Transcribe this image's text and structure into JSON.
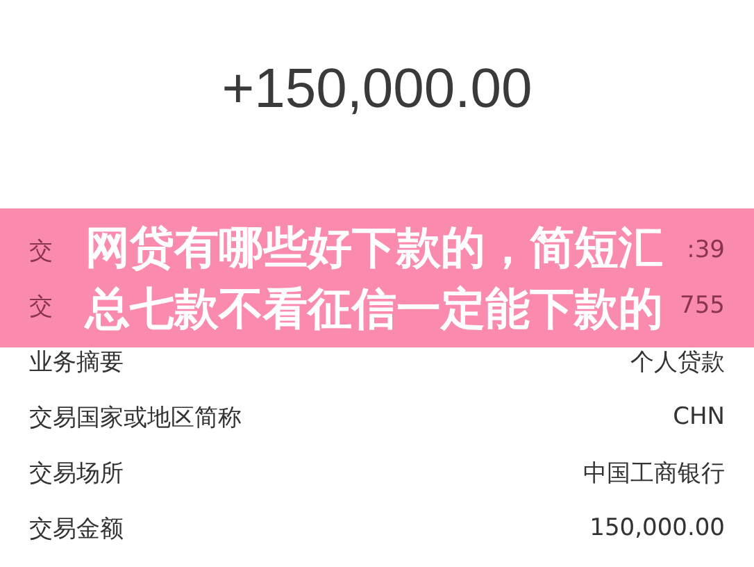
{
  "amount": "+150,000.00",
  "rows": [
    {
      "label": "交",
      "value": ":39"
    },
    {
      "label": "交",
      "value": "755"
    },
    {
      "label": "业务摘要",
      "value": "个人贷款"
    },
    {
      "label": "交易国家或地区简称",
      "value": "CHN"
    },
    {
      "label": "交易场所",
      "value": "中国工商银行"
    },
    {
      "label": "交易金额",
      "value": "150,000.00"
    }
  ],
  "banner": {
    "title": "网贷有哪些好下款的，简短汇总七款不看征信一定能下款的"
  }
}
